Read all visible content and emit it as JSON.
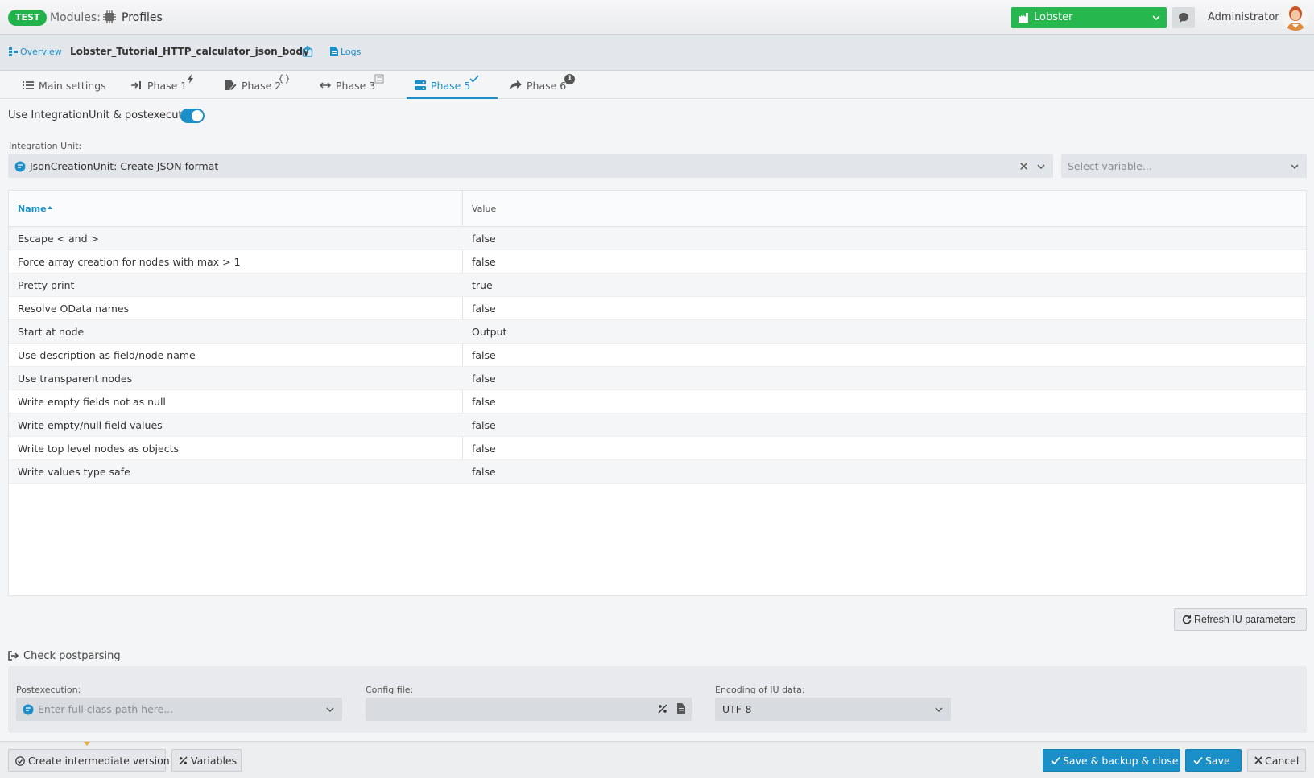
{
  "topbar": {
    "env_badge": "TEST",
    "modules_label": "Modules:",
    "modules_title": "Profiles",
    "company": "Lobster",
    "user": "Administrator"
  },
  "subbar": {
    "overview": "Overview",
    "profile_name": "Lobster_Tutorial_HTTP_calculator_json_body",
    "logs": "Logs"
  },
  "tabs": [
    {
      "label": "Main settings"
    },
    {
      "label": "Phase 1"
    },
    {
      "label": "Phase 2"
    },
    {
      "label": "Phase 3"
    },
    {
      "label": "Phase 5",
      "active": true
    },
    {
      "label": "Phase 6",
      "badge": "1"
    }
  ],
  "main": {
    "toggle_label": "Use IntegrationUnit & postexecution",
    "toggle_on": true,
    "iu_label": "Integration Unit:",
    "iu_value": "JsonCreationUnit: Create JSON format",
    "clear_glyph": "✕",
    "variable_placeholder": "Select variable...",
    "table": {
      "col_name": "Name",
      "col_value": "Value",
      "rows": [
        {
          "name": "Escape < and >",
          "value": "false"
        },
        {
          "name": "Force array creation for nodes with max > 1",
          "value": "false"
        },
        {
          "name": "Pretty print",
          "value": "true"
        },
        {
          "name": "Resolve OData names",
          "value": "false"
        },
        {
          "name": "Start at node",
          "value": "Output"
        },
        {
          "name": "Use description as field/node name",
          "value": "false"
        },
        {
          "name": "Use transparent nodes",
          "value": "false"
        },
        {
          "name": "Write empty fields not as null",
          "value": "false"
        },
        {
          "name": "Write empty/null field values",
          "value": "false"
        },
        {
          "name": "Write top level nodes as objects",
          "value": "false"
        },
        {
          "name": "Write values type safe",
          "value": "false"
        }
      ]
    },
    "refresh_label": "Refresh IU parameters",
    "postparsing_title": "Check postparsing",
    "postexecution_label": "Postexecution:",
    "postexecution_placeholder": "Enter full class path here...",
    "config_label": "Config file:",
    "config_value": "",
    "encoding_label": "Encoding of IU data:",
    "encoding_value": "UTF-8"
  },
  "footer": {
    "intermediate": "Create intermediate version",
    "variables": "Variables",
    "save_backup_close": "Save & backup & close",
    "save": "Save",
    "cancel": "Cancel"
  },
  "colors": {
    "accent": "#1b8fc7",
    "brand_green": "#26b84e",
    "env_badge": "#22b24c"
  }
}
